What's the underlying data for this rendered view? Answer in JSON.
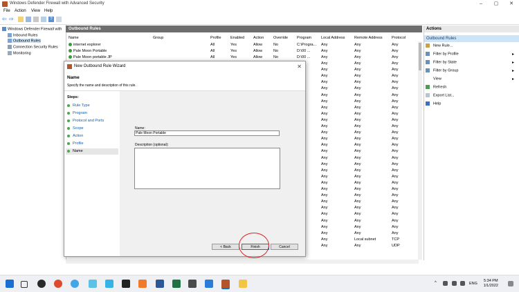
{
  "window": {
    "title": "Windows Defender Firewall with Advanced Security"
  },
  "menu": [
    "File",
    "Action",
    "View",
    "Help"
  ],
  "tree": {
    "root": "Windows Defender Firewall with",
    "items": [
      "Inbound Rules",
      "Outbound Rules",
      "Connection Security Rules",
      "Monitoring"
    ]
  },
  "list": {
    "header": "Outbound Rules",
    "columns": [
      "Name",
      "Group",
      "Profile",
      "Enabled",
      "Action",
      "Override",
      "Program",
      "Local Address",
      "Remote Address",
      "Protocol"
    ],
    "rows": [
      {
        "name": "internet explorer",
        "profile": "All",
        "enabled": "Yes",
        "action": "Allow",
        "override": "No",
        "program": "C:\\Progra...",
        "local": "Any",
        "remote": "Any",
        "protocol": "Any"
      },
      {
        "name": "Pale Moon Portable",
        "profile": "All",
        "enabled": "Yes",
        "action": "Allow",
        "override": "No",
        "program": "D:\\00 ...",
        "local": "Any",
        "remote": "Any",
        "protocol": "Any"
      },
      {
        "name": "Pale Moon portable JP",
        "profile": "All",
        "enabled": "Yes",
        "action": "Allow",
        "override": "No",
        "program": "D:\\00 ...",
        "local": "Any",
        "remote": "Any",
        "protocol": "Any"
      }
    ],
    "bg_local": "Any",
    "bg_remote": "Any",
    "bg_protocol": "Any",
    "bottom_remote": "Local subnet",
    "bottom_protocol": "TCP",
    "bottom_protocol2": "UDP"
  },
  "actions": {
    "header": "Actions",
    "section": "Outbound Rules",
    "items": [
      {
        "label": "New Rule...",
        "icon": "new-rule-icon",
        "arrow": false
      },
      {
        "label": "Filter by Profile",
        "icon": "filter-icon",
        "arrow": true
      },
      {
        "label": "Filter by State",
        "icon": "filter-icon",
        "arrow": true
      },
      {
        "label": "Filter by Group",
        "icon": "filter-icon",
        "arrow": true
      },
      {
        "label": "View",
        "icon": "view-icon",
        "arrow": true
      },
      {
        "label": "Refresh",
        "icon": "refresh-icon",
        "arrow": false
      },
      {
        "label": "Export List...",
        "icon": "export-icon",
        "arrow": false
      },
      {
        "label": "Help",
        "icon": "help-icon",
        "arrow": false
      }
    ]
  },
  "dialog": {
    "title": "New Outbound Rule Wizard",
    "heading": "Name",
    "description": "Specify the name and description of this rule.",
    "steps_label": "Steps:",
    "steps": [
      "Rule Type",
      "Program",
      "Protocol and Ports",
      "Scope",
      "Action",
      "Profile",
      "Name"
    ],
    "name_label": "Name:",
    "name_value": "Pale Moon Portable",
    "desc_label": "Description (optional):",
    "back": "< Back",
    "finish": "Finish",
    "cancel": "Cancel"
  },
  "taskbar": {
    "lang": "ENG",
    "time": "5:34 PM",
    "date": "1/1/2022"
  },
  "colors": {
    "accent": "#0078d7",
    "list_header": "#6e6e6e",
    "actions_selected": "#cde3f6",
    "annotation_circle": "#dd2222"
  }
}
